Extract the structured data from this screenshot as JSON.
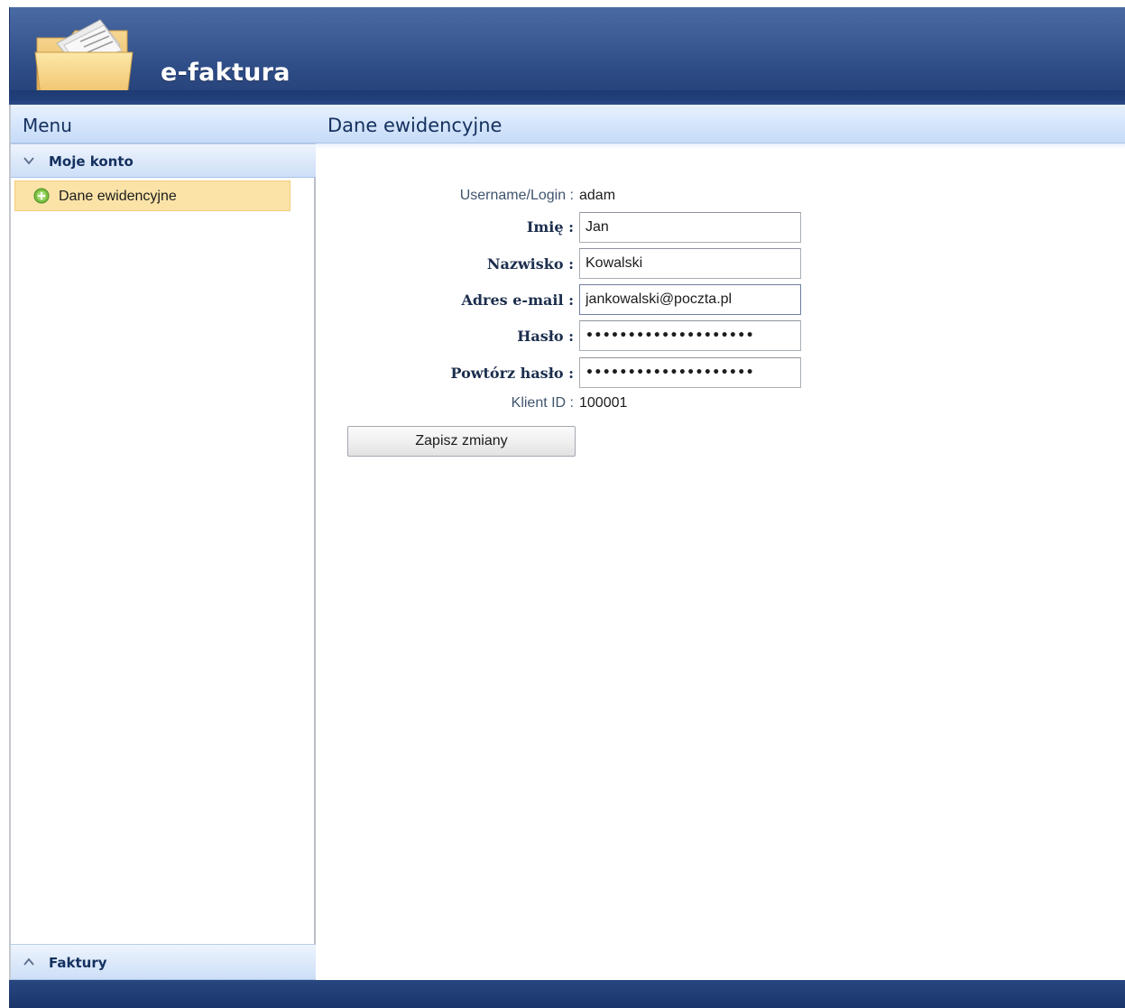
{
  "app": {
    "title": "e-faktura",
    "logo_icon": "folder-with-documents-icon"
  },
  "sidebar": {
    "title": "Menu",
    "groups": [
      {
        "label": "Moje konto",
        "state": "expanded",
        "icon": "chevron-down-icon",
        "items": [
          {
            "label": "Dane ewidencyjne",
            "icon": "green-plus-circle-icon",
            "selected": true
          }
        ]
      },
      {
        "label": "Faktury",
        "state": "collapsed",
        "icon": "chevron-up-icon"
      }
    ]
  },
  "main": {
    "title": "Dane ewidencyjne",
    "form": {
      "username_label": "Username/Login :",
      "username_value": "adam",
      "first_name_label": "Imię :",
      "first_name_value": "Jan",
      "last_name_label": "Nazwisko :",
      "last_name_value": "Kowalski",
      "email_label": "Adres e-mail :",
      "email_value": "jankowalski@poczta.pl",
      "password_label": "Hasło :",
      "password_value": "••••••••••••••••••••",
      "password_repeat_label": "Powtórz hasło :",
      "password_repeat_value": "••••••••••••••••••••",
      "client_id_label": "Klient ID :",
      "client_id_value": "100001",
      "save_label": "Zapisz zmiany"
    }
  },
  "colors": {
    "header_blue": "#2e4c86",
    "panel_header": "#d6e6fb",
    "selected_item": "#fbe3a8",
    "heading_text": "#14305e"
  }
}
